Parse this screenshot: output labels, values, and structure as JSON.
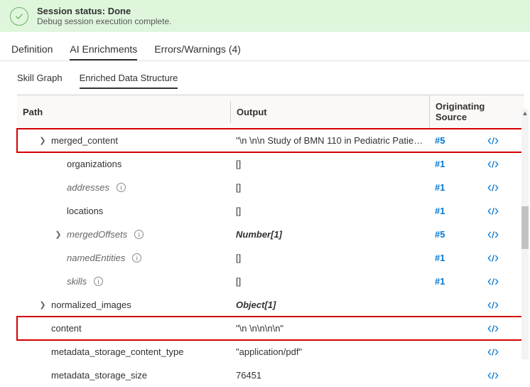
{
  "status": {
    "title": "Session status: Done",
    "subtitle": "Debug session execution complete."
  },
  "tabs": [
    {
      "label": "Definition",
      "active": false
    },
    {
      "label": "AI Enrichments",
      "active": true
    },
    {
      "label": "Errors/Warnings (4)",
      "active": false
    }
  ],
  "subtabs": [
    {
      "label": "Skill Graph",
      "active": false
    },
    {
      "label": "Enriched Data Structure",
      "active": true
    }
  ],
  "columns": {
    "path": "Path",
    "output": "Output",
    "source": "Originating Source"
  },
  "rows": [
    {
      "expandable": true,
      "indent": 1,
      "path": "merged_content",
      "style": "plain",
      "info": false,
      "output": "\"\\n \\n\\n Study of BMN 110 in Pediatric Patient...",
      "out_style": "plain",
      "source": "#5",
      "highlight": true
    },
    {
      "expandable": false,
      "indent": 2,
      "path": "organizations",
      "style": "plain",
      "info": false,
      "output": "[]",
      "out_style": "plain",
      "source": "#1",
      "highlight": false
    },
    {
      "expandable": false,
      "indent": 2,
      "path": "addresses",
      "style": "italic",
      "info": true,
      "output": "[]",
      "out_style": "plain",
      "source": "#1",
      "highlight": false
    },
    {
      "expandable": false,
      "indent": 2,
      "path": "locations",
      "style": "plain",
      "info": false,
      "output": "[]",
      "out_style": "plain",
      "source": "#1",
      "highlight": false
    },
    {
      "expandable": true,
      "indent": 2,
      "path": "mergedOffsets",
      "style": "italic",
      "info": true,
      "output": "Number[1]",
      "out_style": "bolditalic",
      "source": "#5",
      "highlight": false
    },
    {
      "expandable": false,
      "indent": 2,
      "path": "namedEntities",
      "style": "italic",
      "info": true,
      "output": "[]",
      "out_style": "plain",
      "source": "#1",
      "highlight": false
    },
    {
      "expandable": false,
      "indent": 2,
      "path": "skills",
      "style": "italic",
      "info": true,
      "output": "[]",
      "out_style": "plain",
      "source": "#1",
      "highlight": false
    },
    {
      "expandable": true,
      "indent": 1,
      "path": "normalized_images",
      "style": "plain",
      "info": false,
      "output": "Object[1]",
      "out_style": "bolditalic",
      "source": "",
      "highlight": false
    },
    {
      "expandable": false,
      "indent": 1,
      "path": "content",
      "style": "plain",
      "info": false,
      "output": "\"\\n \\n\\n\\n\\n\"",
      "out_style": "plain",
      "source": "",
      "highlight": true
    },
    {
      "expandable": false,
      "indent": 1,
      "path": "metadata_storage_content_type",
      "style": "plain",
      "info": false,
      "output": "\"application/pdf\"",
      "out_style": "plain",
      "source": "",
      "highlight": false
    },
    {
      "expandable": false,
      "indent": 1,
      "path": "metadata_storage_size",
      "style": "plain",
      "info": false,
      "output": "76451",
      "out_style": "plain",
      "source": "",
      "highlight": false
    }
  ]
}
